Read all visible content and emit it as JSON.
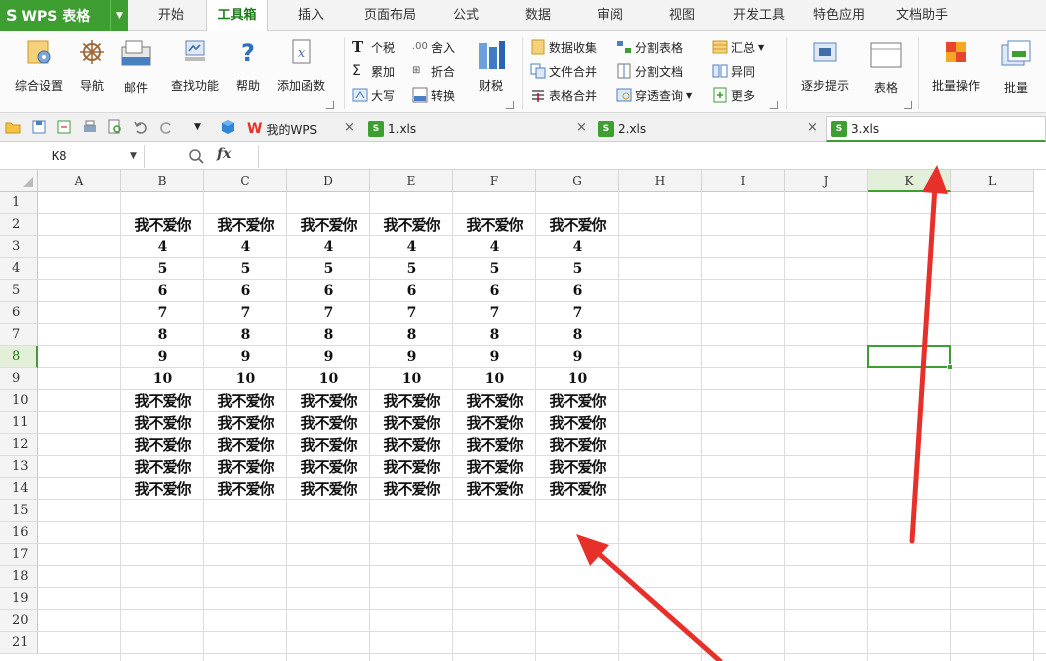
{
  "app": {
    "logo": "WPS 表格"
  },
  "menu": {
    "tabs": [
      "开始",
      "工具箱",
      "插入",
      "页面布局",
      "公式",
      "数据",
      "审阅",
      "视图",
      "开发工具",
      "特色应用",
      "文档助手"
    ],
    "active_index": 1
  },
  "ribbon": {
    "large_buttons": {
      "settings": "综合设置",
      "nav": "导航",
      "mail": "邮件",
      "find": "查找功能",
      "help": "帮助",
      "add_func": "添加函数",
      "tax": "财税",
      "step_hint": "逐步提示",
      "table": "表格",
      "batch_op": "批量操作",
      "batch": "批量"
    },
    "small_buttons": {
      "personal_tax": "个税",
      "round": "舍入",
      "accumulate": "累加",
      "discount": "折合",
      "uppercase": "大写",
      "convert": "转换",
      "data_collect": "数据收集",
      "split_table": "分割表格",
      "file_merge": "文件合并",
      "split_doc": "分割文档",
      "table_merge": "表格合并",
      "cross_query": "穿透查询",
      "summary": "汇总",
      "diff": "异同",
      "more": "更多"
    }
  },
  "tabs_bar": {
    "home_tab": "我的WPS",
    "documents": [
      "1.xls",
      "2.xls",
      "3.xls"
    ],
    "active_index": 2
  },
  "formula_bar": {
    "cell_ref": "K8",
    "fx": "fx",
    "formula": ""
  },
  "sheet": {
    "columns": [
      "A",
      "B",
      "C",
      "D",
      "E",
      "F",
      "G",
      "H",
      "I",
      "J",
      "K",
      "L"
    ],
    "rows": [
      "1",
      "2",
      "3",
      "4",
      "5",
      "6",
      "7",
      "8",
      "9",
      "10",
      "11",
      "12",
      "13",
      "14",
      "15",
      "16",
      "17",
      "18",
      "19",
      "20",
      "21"
    ],
    "selected_cell": "K8",
    "cells": {
      "r2": [
        "我不爱你",
        "我不爱你",
        "我不爱你",
        "我不爱你",
        "我不爱你",
        "我不爱你"
      ],
      "r3": [
        "4",
        "4",
        "4",
        "4",
        "4",
        "4"
      ],
      "r4": [
        "5",
        "5",
        "5",
        "5",
        "5",
        "5"
      ],
      "r5": [
        "6",
        "6",
        "6",
        "6",
        "6",
        "6"
      ],
      "r6": [
        "7",
        "7",
        "7",
        "7",
        "7",
        "7"
      ],
      "r7": [
        "8",
        "8",
        "8",
        "8",
        "8",
        "8"
      ],
      "r8": [
        "9",
        "9",
        "9",
        "9",
        "9",
        "9"
      ],
      "r9": [
        "10",
        "10",
        "10",
        "10",
        "10",
        "10"
      ],
      "r10": [
        "我不爱你",
        "我不爱你",
        "我不爱你",
        "我不爱你",
        "我不爱你",
        "我不爱你"
      ],
      "r11": [
        "我不爱你",
        "我不爱你",
        "我不爱你",
        "我不爱你",
        "我不爱你",
        "我不爱你"
      ],
      "r12": [
        "我不爱你",
        "我不爱你",
        "我不爱你",
        "我不爱你",
        "我不爱你",
        "我不爱你"
      ],
      "r13": [
        "我不爱你",
        "我不爱你",
        "我不爱你",
        "我不爱你",
        "我不爱你",
        "我不爱你"
      ],
      "r14": [
        "我不爱你",
        "我不爱你",
        "我不爱你",
        "我不爱你",
        "我不爱你",
        "我不爱你"
      ]
    }
  },
  "colors": {
    "brand_green": "#3e9e32",
    "annotation_red": "#e8302a"
  }
}
